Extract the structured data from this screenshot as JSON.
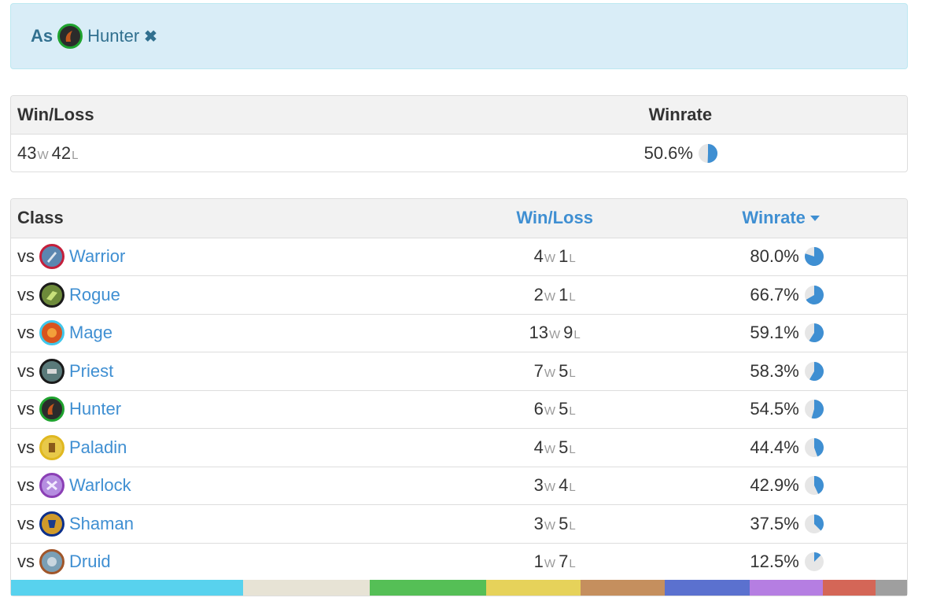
{
  "filter": {
    "prefix": "As",
    "class_name": "Hunter",
    "remove_glyph": "✖",
    "icon": "hunter-icon"
  },
  "summary": {
    "headers": {
      "winloss": "Win/Loss",
      "winrate": "Winrate"
    },
    "wins": "43",
    "losses": "42",
    "win_unit": "W",
    "loss_unit": "L",
    "winrate": "50.6%",
    "winrate_fraction": 0.506
  },
  "table": {
    "headers": {
      "class": "Class",
      "winloss": "Win/Loss",
      "winrate": "Winrate"
    },
    "rows": [
      {
        "vs": "vs",
        "class": "Warrior",
        "icon": "warrior-icon",
        "ring": "#c41f3b",
        "fill": "#5b86b0",
        "wins": "4",
        "losses": "1",
        "winrate": "80.0%",
        "fraction": 0.8
      },
      {
        "vs": "vs",
        "class": "Rogue",
        "icon": "rogue-icon",
        "ring": "#1a1a1a",
        "fill": "#6d8a3a",
        "wins": "2",
        "losses": "1",
        "winrate": "66.7%",
        "fraction": 0.667
      },
      {
        "vs": "vs",
        "class": "Mage",
        "icon": "mage-icon",
        "ring": "#40c7eb",
        "fill": "#d9541e",
        "wins": "13",
        "losses": "9",
        "winrate": "59.1%",
        "fraction": 0.591
      },
      {
        "vs": "vs",
        "class": "Priest",
        "icon": "priest-icon",
        "ring": "#1a1a1a",
        "fill": "#5a7a7a",
        "wins": "7",
        "losses": "5",
        "winrate": "58.3%",
        "fraction": 0.583
      },
      {
        "vs": "vs",
        "class": "Hunter",
        "icon": "hunter-icon",
        "ring": "#1fa32f",
        "fill": "#2b2b2b",
        "wins": "6",
        "losses": "5",
        "winrate": "54.5%",
        "fraction": 0.545
      },
      {
        "vs": "vs",
        "class": "Paladin",
        "icon": "paladin-icon",
        "ring": "#e0b820",
        "fill": "#e8c94a",
        "wins": "4",
        "losses": "5",
        "winrate": "44.4%",
        "fraction": 0.444
      },
      {
        "vs": "vs",
        "class": "Warlock",
        "icon": "warlock-icon",
        "ring": "#8b3fb5",
        "fill": "#b58de0",
        "wins": "3",
        "losses": "4",
        "winrate": "42.9%",
        "fraction": 0.429
      },
      {
        "vs": "vs",
        "class": "Shaman",
        "icon": "shaman-icon",
        "ring": "#0b2f8a",
        "fill": "#d09a2a",
        "wins": "3",
        "losses": "5",
        "winrate": "37.5%",
        "fraction": 0.375
      },
      {
        "vs": "vs",
        "class": "Druid",
        "icon": "druid-icon",
        "ring": "#a0562a",
        "fill": "#7a9fb5",
        "wins": "1",
        "losses": "7",
        "winrate": "12.5%",
        "fraction": 0.125
      }
    ]
  },
  "colors": {
    "accent": "#3f8fd2",
    "pie_fill": "#3f8fd2",
    "pie_bg": "#e6e6e6",
    "stripe": [
      "#58d2ee",
      "#e7e3d5",
      "#55bf56",
      "#e6d25a",
      "#c58f5e",
      "#5b71cf",
      "#b57ee2",
      "#d46657",
      "#9f9f9f"
    ]
  },
  "stripe_shares": [
    0.259,
    0.141,
    0.13,
    0.106,
    0.094,
    0.094,
    0.082,
    0.059,
    0.035
  ]
}
